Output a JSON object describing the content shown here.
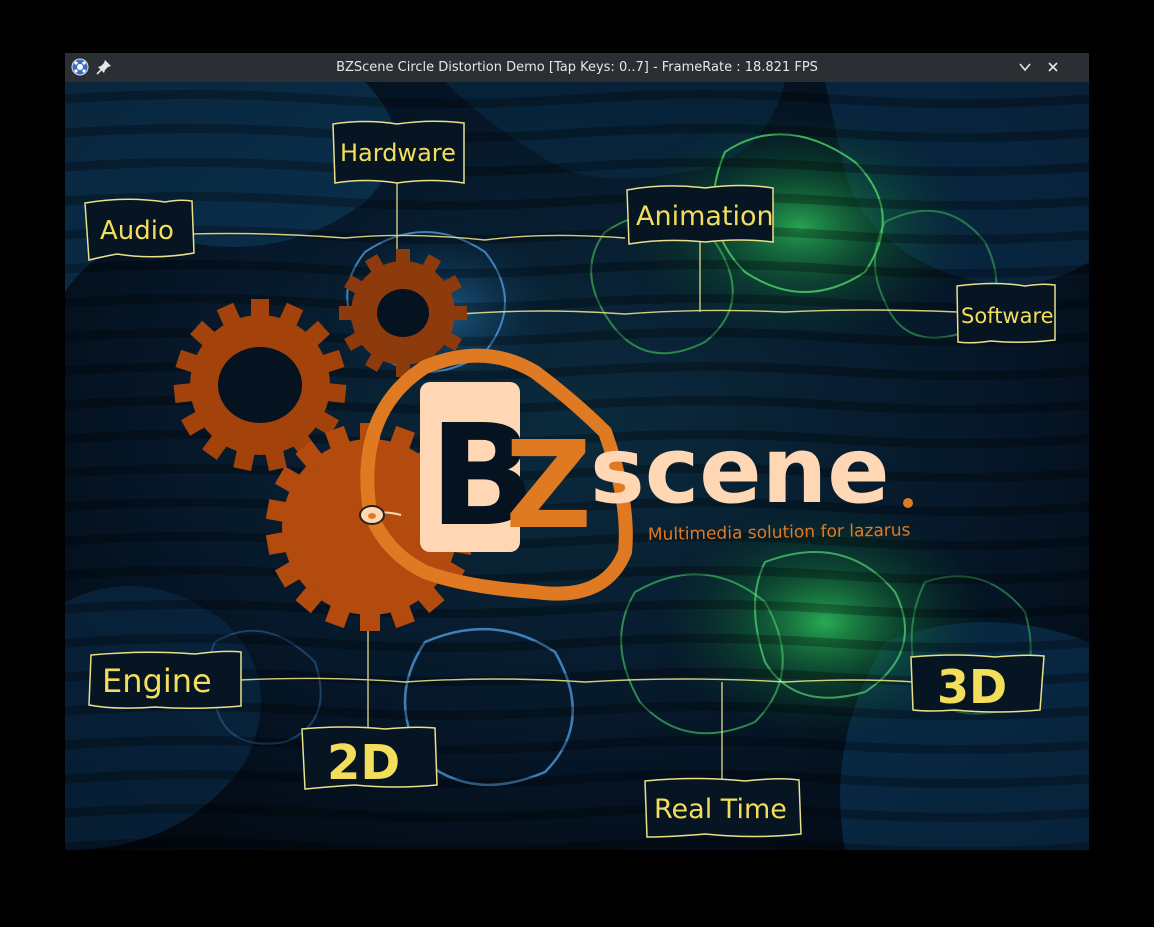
{
  "window": {
    "title": "BZScene Circle Distortion Demo [Tap Keys: 0..7] - FrameRate : 18.821 FPS",
    "icons": {
      "app": "app-icon",
      "pin": "pin-icon",
      "minimize": "chevron-down-icon",
      "close": "close-icon"
    }
  },
  "scene": {
    "labels": {
      "hardware": "Hardware",
      "audio": "Audio",
      "animation": "Animation",
      "software": "Software",
      "engine": "Engine",
      "three_d": "3D",
      "two_d": "2D",
      "real_time": "Real Time"
    },
    "logo": {
      "b": "B",
      "z": "Z",
      "scene": "scene",
      "tagline": "Multimedia solution for lazarus"
    }
  },
  "colors": {
    "label_text": "#f2de5a",
    "logo_orange": "#e07a22",
    "logo_peach": "#ffd7b5",
    "gear": "#a4420c",
    "titlebar": "#2b2e33"
  }
}
